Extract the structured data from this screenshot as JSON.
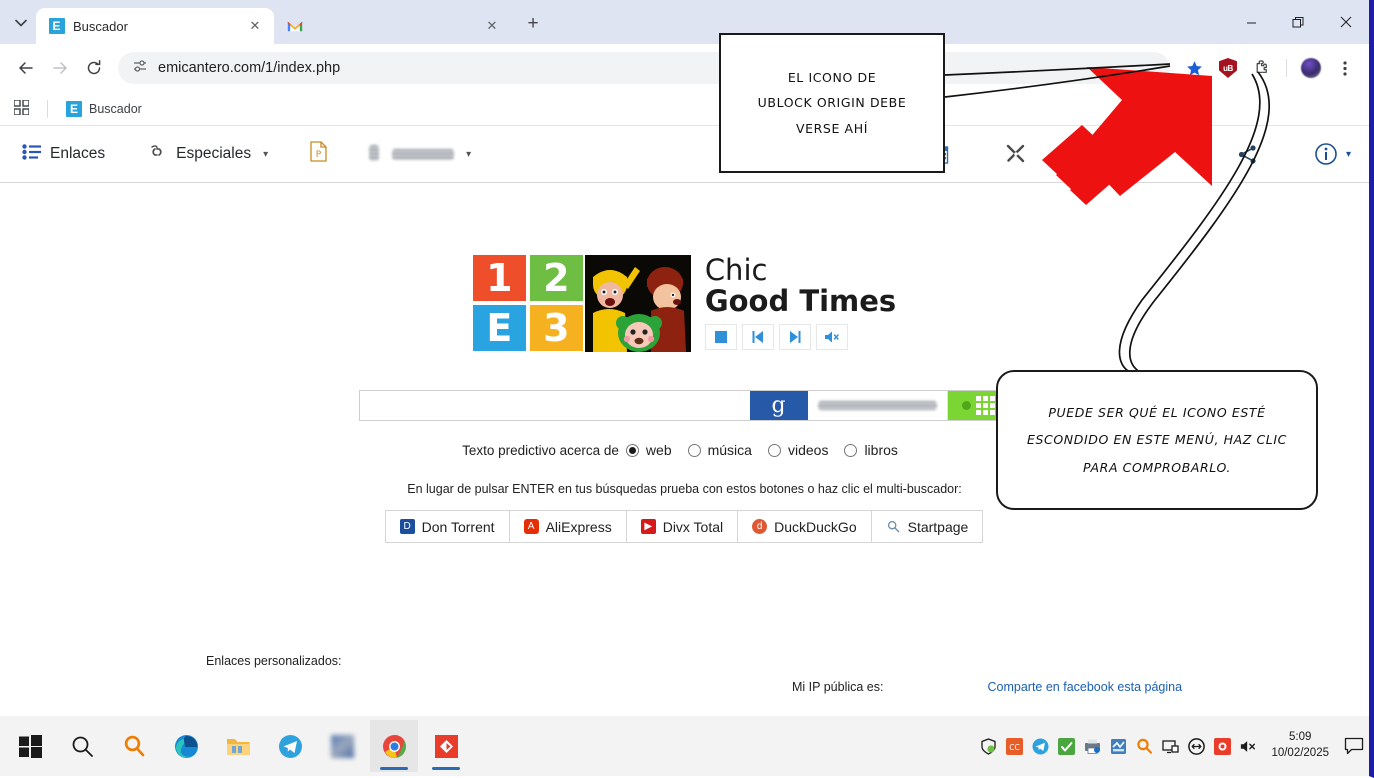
{
  "window": {
    "minimize_label": "Minimizar",
    "restore_label": "Restaurar",
    "close_label": "Cerrar"
  },
  "tabs": {
    "search_tabs_icon": "chevron-down-icon",
    "items": [
      {
        "title": "Buscador",
        "favicon": "E",
        "active": true,
        "blurred": false
      },
      {
        "title": "",
        "favicon": "gmail-icon",
        "active": false,
        "blurred": true
      }
    ],
    "new_tab_label": "+"
  },
  "navigation": {
    "back_icon": "←",
    "forward_icon": "→",
    "reload_icon": "⟳",
    "site_info_icon": "tune-icon",
    "url": "emicantero.com/1/index.php",
    "url_blurred_suffix": true,
    "bookmark_icon": "star-icon",
    "extension_badge": "uB",
    "extensions_icon": "puzzle-icon",
    "profile_icon": "avatar",
    "menu_icon": "three-dots-icon"
  },
  "bookmarks_bar": {
    "apps_icon": "apps-grid-icon",
    "items": [
      {
        "label": "Buscador",
        "favicon": "E"
      }
    ]
  },
  "page_toolbar": {
    "left_items": [
      {
        "label": "Enlaces",
        "icon": "list-icon",
        "caret": false
      },
      {
        "label": "Especiales",
        "icon": "link-icon",
        "caret": true
      },
      {
        "label": "",
        "icon": "pdf-p-icon",
        "caret": false
      },
      {
        "label": "",
        "icon": "blurred-icon",
        "caret": true,
        "blurred": true
      }
    ],
    "right_items": [
      {
        "label": "",
        "icon": "calendar-icon"
      },
      {
        "label": "",
        "icon": "tools-icon"
      },
      {
        "label": "",
        "icon": "share-icon"
      },
      {
        "label": "",
        "icon": "info-icon",
        "caret": true
      }
    ]
  },
  "hero": {
    "tiles": [
      {
        "char": "1",
        "color": "#ef4e2b"
      },
      {
        "char": "2",
        "color": "#6fbe44"
      },
      {
        "char": "E",
        "color": "#2aa4e0"
      },
      {
        "char": "3",
        "color": "#f5b120"
      }
    ],
    "artwork_name": "cartoon-characters-thumbnail",
    "brand_line1": "Chic",
    "brand_line2": "Good Times",
    "media_buttons": [
      {
        "name": "stop-button",
        "glyph": "■"
      },
      {
        "name": "previous-button",
        "glyph": "◀|"
      },
      {
        "name": "next-button",
        "glyph": "|▶"
      },
      {
        "name": "mute-button",
        "glyph": "🔇"
      }
    ]
  },
  "search": {
    "input_value": "",
    "input_placeholder": "",
    "google_button_label": "g",
    "blurred_field_label": "",
    "grid_button_name": "multi-search-grid-button"
  },
  "predictive": {
    "label": "Texto predictivo acerca de",
    "options": [
      {
        "label": "web",
        "selected": true
      },
      {
        "label": "música",
        "selected": false
      },
      {
        "label": "videos",
        "selected": false
      },
      {
        "label": "libros",
        "selected": false
      }
    ]
  },
  "engines": {
    "hint": "En lugar de pulsar ENTER en tus búsquedas prueba con estos botones o haz clic el multi-buscador:",
    "buttons": [
      {
        "label": "Don Torrent",
        "icon": "dontorrent-icon"
      },
      {
        "label": "AliExpress",
        "icon": "aliexpress-icon"
      },
      {
        "label": "Divx Total",
        "icon": "divxtotal-icon"
      },
      {
        "label": "DuckDuckGo",
        "icon": "duckduckgo-icon"
      },
      {
        "label": "Startpage",
        "icon": "startpage-icon"
      }
    ]
  },
  "footer": {
    "custom_links_label": "Enlaces personalizados:",
    "ip_label": "Mi IP pública es:",
    "ip_value_blurred": true,
    "facebook_link": "Comparte en facebook esta página"
  },
  "annotations": [
    {
      "id": "callout-1",
      "lines": [
        "EL ICONO DE",
        "UBLOCK ORIGIN DEBE",
        "VERSE AHÍ"
      ]
    },
    {
      "id": "callout-2",
      "lines": [
        "PUEDE SER QUÉ EL ICONO ESTÉ",
        "ESCONDIDO EN ESTE MENÚ, HAZ CLIC",
        "PARA COMPROBARLO."
      ]
    }
  ],
  "arrow": {
    "name": "red-arrow-pointer",
    "color": "#ee1111"
  },
  "taskbar": {
    "items": [
      {
        "name": "start-button",
        "icon": "windows-logo-icon",
        "running": false
      },
      {
        "name": "search-button",
        "icon": "magnifier-icon",
        "running": false
      },
      {
        "name": "everything-search",
        "icon": "orange-magnifier-icon",
        "running": false
      },
      {
        "name": "edge-button",
        "icon": "edge-icon",
        "running": false
      },
      {
        "name": "file-explorer-button",
        "icon": "folder-icon",
        "running": false
      },
      {
        "name": "telegram-button",
        "icon": "telegram-icon",
        "running": false
      },
      {
        "name": "blurred-app-button",
        "icon": "blurred-app-icon",
        "running": false
      },
      {
        "name": "chrome-button",
        "icon": "chrome-icon",
        "running": true
      },
      {
        "name": "red-app-button",
        "icon": "red-diamond-icon",
        "running": true
      }
    ],
    "tray": [
      {
        "name": "security-shield-icon"
      },
      {
        "name": "ccleaner-icon"
      },
      {
        "name": "telegram-tray-icon"
      },
      {
        "name": "antivirus-icon"
      },
      {
        "name": "printer-icon"
      },
      {
        "name": "network-tray-icon"
      },
      {
        "name": "everything-tray-icon"
      },
      {
        "name": "display-tray-icon"
      },
      {
        "name": "mouse-tray-icon"
      },
      {
        "name": "red-tray-icon"
      },
      {
        "name": "volume-muted-icon"
      }
    ],
    "clock_time": "5:09",
    "clock_date": "10/02/2025",
    "notification_icon": "notification-icon"
  }
}
